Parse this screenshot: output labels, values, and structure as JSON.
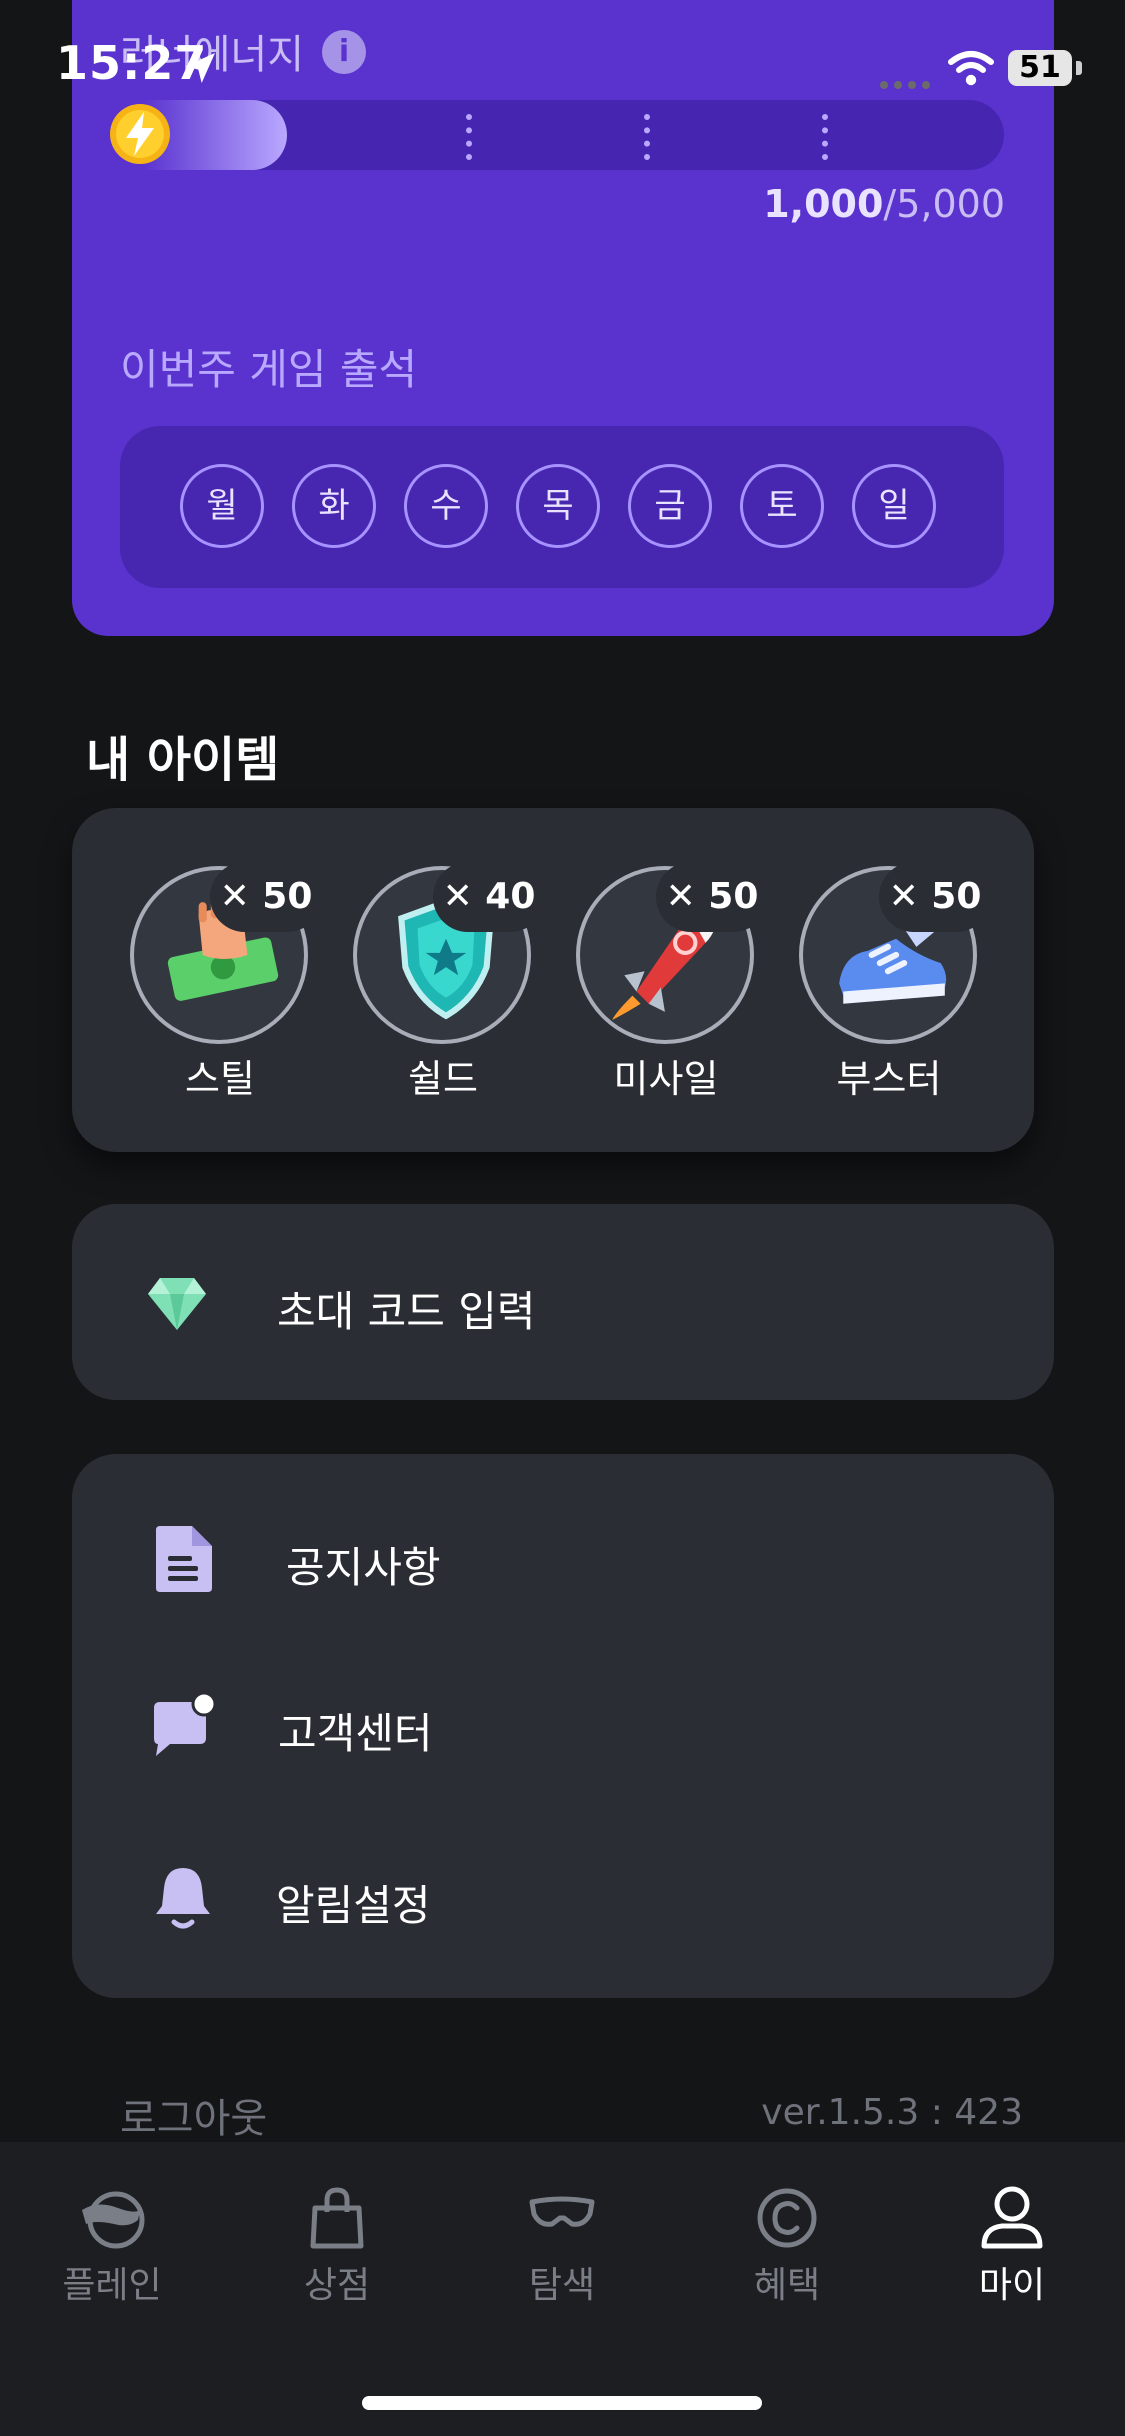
{
  "status_bar": {
    "time": "15:27",
    "battery": "51"
  },
  "energy": {
    "title": "러너에너지",
    "current": "1,000",
    "total": "/5,000",
    "fill_fraction": 0.2
  },
  "attendance": {
    "title": "이번주 게임 출석",
    "days": [
      "월",
      "화",
      "수",
      "목",
      "금",
      "토",
      "일"
    ]
  },
  "items": {
    "title": "내 아이템",
    "list": [
      {
        "label": "스틸",
        "count": "✕ 50",
        "icon": "money-hand-icon"
      },
      {
        "label": "쉴드",
        "count": "✕ 40",
        "icon": "shield-icon"
      },
      {
        "label": "미사일",
        "count": "✕ 50",
        "icon": "missile-icon"
      },
      {
        "label": "부스터",
        "count": "✕ 50",
        "icon": "sneaker-icon"
      }
    ]
  },
  "invite": {
    "label": "초대 코드 입력",
    "icon": "gem-icon"
  },
  "menu": [
    {
      "label": "공지사항",
      "icon": "document-icon"
    },
    {
      "label": "고객센터",
      "icon": "chat-icon"
    },
    {
      "label": "알림설정",
      "icon": "bell-icon"
    }
  ],
  "footer": {
    "logout": "로그아웃",
    "version": "ver.1.5.3 : 423"
  },
  "tabs": [
    {
      "label": "플레인",
      "icon": "plane-avatar-icon"
    },
    {
      "label": "상점",
      "icon": "shopping-bag-icon"
    },
    {
      "label": "탐색",
      "icon": "goggles-icon"
    },
    {
      "label": "혜택",
      "icon": "coin-icon"
    },
    {
      "label": "마이",
      "icon": "user-icon",
      "active": true
    }
  ],
  "colors": {
    "accent": "#5a33cf",
    "card": "#2a2d33",
    "background": "#141517"
  }
}
